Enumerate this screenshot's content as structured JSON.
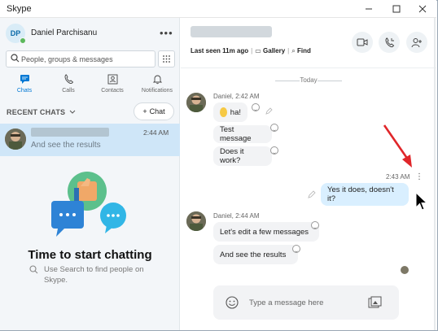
{
  "window": {
    "title": "Skype"
  },
  "profile": {
    "initials": "DP",
    "name": "Daniel Parchisanu"
  },
  "search": {
    "placeholder": "People, groups & messages"
  },
  "nav": [
    {
      "label": "Chats",
      "icon": "chat-icon",
      "active": true
    },
    {
      "label": "Calls",
      "icon": "phone-icon",
      "active": false
    },
    {
      "label": "Contacts",
      "icon": "contacts-icon",
      "active": false
    },
    {
      "label": "Notifications",
      "icon": "bell-icon",
      "active": false
    }
  ],
  "recent": {
    "header": "RECENT CHATS",
    "new_chat_label": "Chat"
  },
  "chat_list": [
    {
      "time": "2:44 AM",
      "last_message": "And see the results"
    }
  ],
  "empty_state": {
    "title": "Time to start chatting",
    "subtitle": "Use Search to find people on Skype."
  },
  "conversation": {
    "last_seen": "Last seen 11m ago",
    "gallery_label": "Gallery",
    "find_label": "Find",
    "day_separator": "Today",
    "messages": [
      {
        "meta": "Daniel, 2:42 AM",
        "text": "ha!",
        "emoji": true
      },
      {
        "text": "Test message"
      },
      {
        "text": "Does it work?"
      },
      {
        "meta": "2:43 AM",
        "text": "Yes it does, doesn't it?",
        "mine": true
      },
      {
        "meta": "Daniel, 2:44 AM",
        "text": "Let's edit a few messages"
      },
      {
        "text": "And see the results"
      }
    ],
    "compose_placeholder": "Type a message here"
  },
  "colors": {
    "accent": "#0078d4",
    "selected_chat": "#cfe6f8",
    "my_bubble": "#d9efff",
    "annotation_arrow": "#e0262a"
  }
}
